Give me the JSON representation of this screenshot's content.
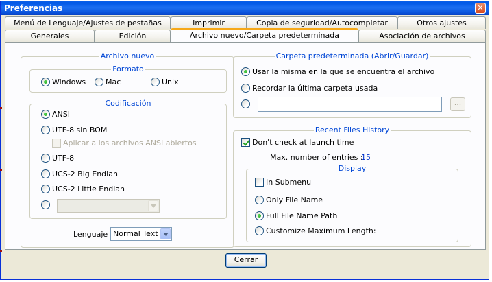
{
  "window": {
    "title": "Preferencias"
  },
  "tabs": {
    "row1": [
      "Menú de Lenguaje/Ajustes de pestañas",
      "Imprimir",
      "Copia de seguridad/Autocompletar",
      "Otros ajustes"
    ],
    "row2": [
      "Generales",
      "Edición",
      "Archivo nuevo/Carpeta predeterminada",
      "Asociación de archivos"
    ]
  },
  "archivo_nuevo": {
    "title": "Archivo nuevo",
    "formato": {
      "title": "Formato",
      "options": [
        "Windows",
        "Mac",
        "Unix"
      ],
      "selected": "Windows"
    },
    "codificacion": {
      "title": "Codificación",
      "options": [
        "ANSI",
        "UTF-8 sin BOM",
        "UTF-8",
        "UCS-2 Big Endian",
        "UCS-2 Little Endian"
      ],
      "selected": "ANSI",
      "apply_ansi_label": "Aplicar a los archivos ANSI abiertos"
    },
    "lenguaje": {
      "label": "Lenguaje",
      "value": "Normal Text"
    }
  },
  "carpeta": {
    "title": "Carpeta predeterminada (Abrir/Guardar)",
    "options": [
      "Usar la misma en la que se encuentra el archivo",
      "Recordar la última carpeta usada"
    ],
    "selected": "Usar la misma en la que se encuentra el archivo",
    "path_value": "",
    "browse_label": "..."
  },
  "recent": {
    "title": "Recent Files History",
    "dont_check_label": "Don't check at launch time",
    "dont_check_checked": true,
    "max_label": "Max. number of entries :",
    "max_value": "15",
    "display": {
      "title": "Display",
      "in_submenu_label": "In Submenu",
      "options": [
        "Only File Name",
        "Full File Name Path",
        "Customize Maximum Length:"
      ],
      "selected": "Full File Name Path"
    }
  },
  "footer": {
    "close_label": "Cerrar"
  }
}
